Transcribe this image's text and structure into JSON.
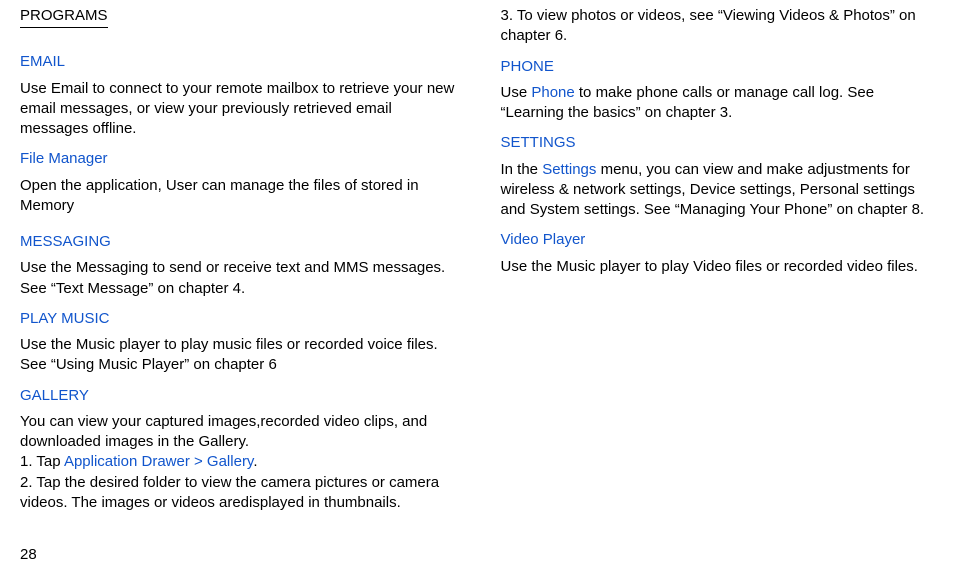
{
  "page": {
    "title": "PROGRAMS",
    "number": "28"
  },
  "sections": {
    "email": {
      "title": "EMAIL",
      "body": "Use Email to connect to your remote mailbox to retrieve your new email messages, or view your previously retrieved email messages offline."
    },
    "filemgr": {
      "title": "File Manager",
      "body": "Open the application, User can manage the files of stored in Memory"
    },
    "messaging": {
      "title": "MESSAGING",
      "body": "Use the Messaging to send or receive text and MMS messages. See “Text Message” on chapter 4."
    },
    "playmusic": {
      "title": "PLAY MUSIC",
      "body": "Use the Music player to play music files or recorded voice files. See “Using Music Player” on chapter 6"
    },
    "gallery": {
      "title": "GALLERY",
      "line1": "You can view your captured images,recorded video clips, and downloaded images in the Gallery.",
      "line2a": "1. Tap ",
      "line2link": "Application Drawer > Gallery",
      "line2b": ".",
      "line3": "2. Tap the desired folder to view the camera pictures or camera videos. The images or videos aredisplayed in thumbnails.",
      "line4": "3. To view photos or videos, see “Viewing Videos & Photos” on chapter 6."
    },
    "phone": {
      "title": "PHONE",
      "body1": "Use ",
      "link": "Phone",
      "body2": " to make phone calls or manage call log. See “Learning the basics” on chapter 3."
    },
    "settings": {
      "title": "SETTINGS",
      "body1": "In the ",
      "link": "Settings",
      "body2": " menu, you can view and make adjustments for wireless & network settings, Device settings, Personal settings and System settings. See “Managing Your Phone” on chapter 8."
    },
    "videoplayer": {
      "title": "Video Player",
      "body": "Use the Music player to play Video files or recorded video files."
    }
  }
}
